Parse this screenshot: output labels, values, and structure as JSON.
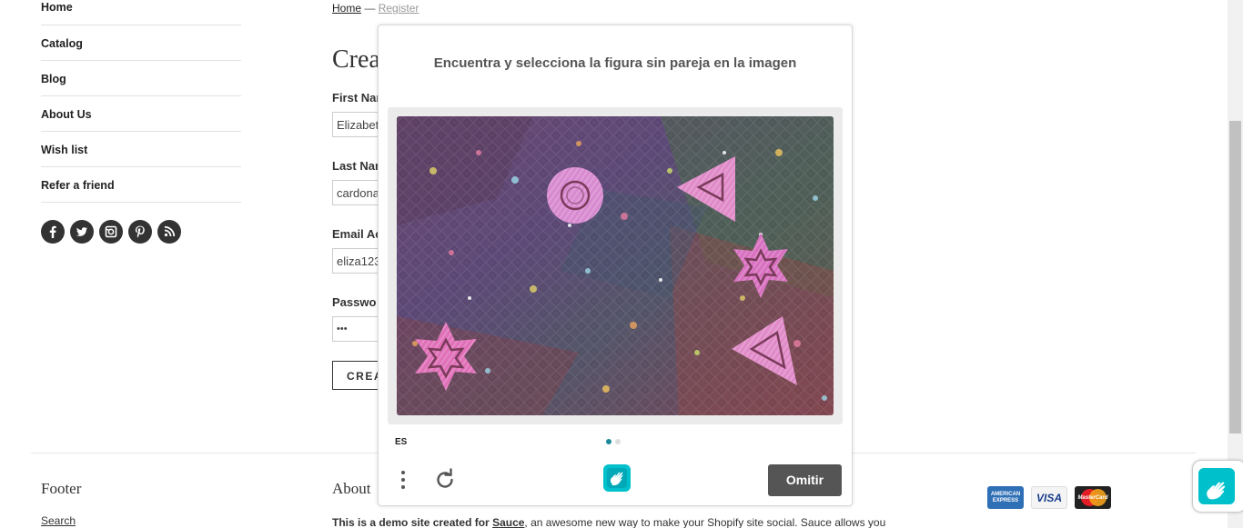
{
  "sidebar": {
    "items": [
      {
        "label": "Home"
      },
      {
        "label": "Catalog"
      },
      {
        "label": "Blog"
      },
      {
        "label": "About Us"
      },
      {
        "label": "Wish list"
      },
      {
        "label": "Refer a friend"
      }
    ],
    "social_icons": [
      "facebook-icon",
      "twitter-icon",
      "instagram-icon",
      "pinterest-icon",
      "rss-icon"
    ]
  },
  "breadcrumb": {
    "home": "Home",
    "separator": "—",
    "current": "Register"
  },
  "form": {
    "heading": "Crea",
    "first_name_label": "First Nar",
    "first_name_value": "Elizabet",
    "last_name_label": "Last Nar",
    "last_name_value": "cardona",
    "email_label": "Email Ac",
    "email_value": "eliza123",
    "password_label": "Passwo",
    "password_value": "•••",
    "create_label": "CREA"
  },
  "footer": {
    "title": "Footer",
    "about_title": "About",
    "search_link": "Search",
    "text_bold": "This is a demo site created for ",
    "text_link": "Sauce",
    "text_rest": ", an awesome new way to make your Shopify site social. Sauce allows you",
    "cards": {
      "amex": "AMERICAN EXPRESS",
      "visa": "VISA",
      "mastercard": "MasterCard"
    }
  },
  "captcha": {
    "prompt": "Encuentra y selecciona la figura sin pareja en la imagen",
    "language": "ES",
    "skip_label": "Omitir",
    "page_dots": [
      "#1a8a9a",
      "#dddddd"
    ],
    "accent_color": "#00b8c8"
  }
}
